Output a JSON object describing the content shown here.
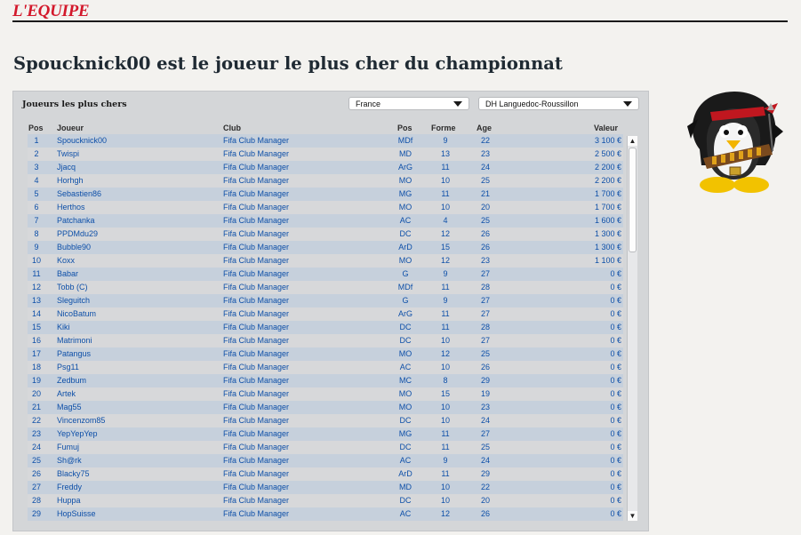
{
  "site": {
    "logo": "L'EQUIPE"
  },
  "headline": "Spoucknick00 est le joueur le plus cher du championnat",
  "panel": {
    "title": "Joueurs les plus chers",
    "country_select": "France",
    "league_select": "DH Languedoc-Roussillon"
  },
  "table": {
    "headers": {
      "pos": "Pos",
      "player": "Joueur",
      "club": "Club",
      "position": "Pos",
      "forme": "Forme",
      "age": "Age",
      "value": "Valeur"
    },
    "rows": [
      {
        "pos": "1",
        "player": "Spoucknick00",
        "club": "Fifa Club Manager",
        "position": "MDf",
        "forme": "9",
        "age": "22",
        "value": "3 100 €"
      },
      {
        "pos": "2",
        "player": "Twispi",
        "club": "Fifa Club Manager",
        "position": "MD",
        "forme": "13",
        "age": "23",
        "value": "2 500 €"
      },
      {
        "pos": "3",
        "player": "Jjacq",
        "club": "Fifa Club Manager",
        "position": "ArG",
        "forme": "11",
        "age": "24",
        "value": "2 200 €"
      },
      {
        "pos": "4",
        "player": "Horhgh",
        "club": "Fifa Club Manager",
        "position": "MO",
        "forme": "10",
        "age": "25",
        "value": "2 200 €"
      },
      {
        "pos": "5",
        "player": "Sebastien86",
        "club": "Fifa Club Manager",
        "position": "MG",
        "forme": "11",
        "age": "21",
        "value": "1 700 €"
      },
      {
        "pos": "6",
        "player": "Herthos",
        "club": "Fifa Club Manager",
        "position": "MO",
        "forme": "10",
        "age": "20",
        "value": "1 700 €"
      },
      {
        "pos": "7",
        "player": "Patchanka",
        "club": "Fifa Club Manager",
        "position": "AC",
        "forme": "4",
        "age": "25",
        "value": "1 600 €"
      },
      {
        "pos": "8",
        "player": "PPDMdu29",
        "club": "Fifa Club Manager",
        "position": "DC",
        "forme": "12",
        "age": "26",
        "value": "1 300 €"
      },
      {
        "pos": "9",
        "player": "Bubble90",
        "club": "Fifa Club Manager",
        "position": "ArD",
        "forme": "15",
        "age": "26",
        "value": "1 300 €"
      },
      {
        "pos": "10",
        "player": "Koxx",
        "club": "Fifa Club Manager",
        "position": "MO",
        "forme": "12",
        "age": "23",
        "value": "1 100 €"
      },
      {
        "pos": "11",
        "player": "Babar",
        "club": "Fifa Club Manager",
        "position": "G",
        "forme": "9",
        "age": "27",
        "value": "0 €"
      },
      {
        "pos": "12",
        "player": "Tobb (C)",
        "club": "Fifa Club Manager",
        "position": "MDf",
        "forme": "11",
        "age": "28",
        "value": "0 €"
      },
      {
        "pos": "13",
        "player": "Sleguitch",
        "club": "Fifa Club Manager",
        "position": "G",
        "forme": "9",
        "age": "27",
        "value": "0 €"
      },
      {
        "pos": "14",
        "player": "NicoBatum",
        "club": "Fifa Club Manager",
        "position": "ArG",
        "forme": "11",
        "age": "27",
        "value": "0 €"
      },
      {
        "pos": "15",
        "player": "Kiki",
        "club": "Fifa Club Manager",
        "position": "DC",
        "forme": "11",
        "age": "28",
        "value": "0 €"
      },
      {
        "pos": "16",
        "player": "Matrimoni",
        "club": "Fifa Club Manager",
        "position": "DC",
        "forme": "10",
        "age": "27",
        "value": "0 €"
      },
      {
        "pos": "17",
        "player": "Patangus",
        "club": "Fifa Club Manager",
        "position": "MO",
        "forme": "12",
        "age": "25",
        "value": "0 €"
      },
      {
        "pos": "18",
        "player": "Psg11",
        "club": "Fifa Club Manager",
        "position": "AC",
        "forme": "10",
        "age": "26",
        "value": "0 €"
      },
      {
        "pos": "19",
        "player": "Zedbum",
        "club": "Fifa Club Manager",
        "position": "MC",
        "forme": "8",
        "age": "29",
        "value": "0 €"
      },
      {
        "pos": "20",
        "player": "Artek",
        "club": "Fifa Club Manager",
        "position": "MO",
        "forme": "15",
        "age": "19",
        "value": "0 €"
      },
      {
        "pos": "21",
        "player": "Mag55",
        "club": "Fifa Club Manager",
        "position": "MO",
        "forme": "10",
        "age": "23",
        "value": "0 €"
      },
      {
        "pos": "22",
        "player": "Vincenzom85",
        "club": "Fifa Club Manager",
        "position": "DC",
        "forme": "10",
        "age": "24",
        "value": "0 €"
      },
      {
        "pos": "23",
        "player": "YepYepYep",
        "club": "Fifa Club Manager",
        "position": "MG",
        "forme": "11",
        "age": "27",
        "value": "0 €"
      },
      {
        "pos": "24",
        "player": "Fumuj",
        "club": "Fifa Club Manager",
        "position": "DC",
        "forme": "11",
        "age": "25",
        "value": "0 €"
      },
      {
        "pos": "25",
        "player": "Sh@rk",
        "club": "Fifa Club Manager",
        "position": "AC",
        "forme": "9",
        "age": "24",
        "value": "0 €"
      },
      {
        "pos": "26",
        "player": "Blacky75",
        "club": "Fifa Club Manager",
        "position": "ArD",
        "forme": "11",
        "age": "29",
        "value": "0 €"
      },
      {
        "pos": "27",
        "player": "Freddy",
        "club": "Fifa Club Manager",
        "position": "MD",
        "forme": "10",
        "age": "22",
        "value": "0 €"
      },
      {
        "pos": "28",
        "player": "Huppa",
        "club": "Fifa Club Manager",
        "position": "DC",
        "forme": "10",
        "age": "20",
        "value": "0 €"
      },
      {
        "pos": "29",
        "player": "HopSuisse",
        "club": "Fifa Club Manager",
        "position": "AC",
        "forme": "12",
        "age": "26",
        "value": "0 €"
      }
    ]
  },
  "icons": {
    "chevron": "chevron-down-icon",
    "scroll_up": "arrow-up-icon",
    "scroll_down": "arrow-down-icon",
    "mascot": "penguin-mascot-icon"
  },
  "colors": {
    "brand": "#d3182b",
    "link": "#0d4fa8",
    "row_odd": "#c6d0dc",
    "row_even": "#d7d8da"
  }
}
